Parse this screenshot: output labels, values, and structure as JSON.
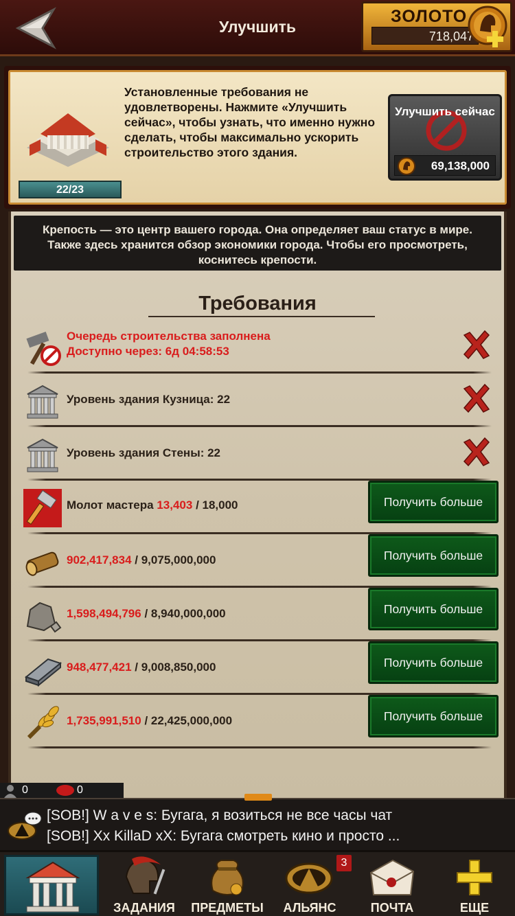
{
  "header": {
    "title": "Улучшить",
    "gold_label": "ЗОЛОТО",
    "gold_value": "718,047"
  },
  "upgrade": {
    "level": "22/23",
    "description": "Установленные требования не удовлетворены. Нажмите «Улучшить сейчас», чтобы узнать, что именно нужно сделать, чтобы максимально ускорить строительство этого здания.",
    "button_label": "Улучшить сейчас",
    "cost": "69,138,000"
  },
  "info_text": "Крепость — это центр вашего города. Она определяет ваш статус в мире. Также здесь хранится обзор экономики города. Чтобы его просмотреть, коснитесь крепости.",
  "requirements": {
    "title": "Требования",
    "queue_line1": "Очередь строительства заполнена",
    "queue_line2": "Доступно через: 6д 04:58:53",
    "forge": "Уровень здания Кузница: 22",
    "walls": "Уровень здания Стены: 22",
    "items": [
      {
        "icon": "master-hammer-icon",
        "label": "Молот мастера",
        "have": "13,403",
        "need": "/ 18,000"
      },
      {
        "icon": "wood-icon",
        "label": "",
        "have": "902,417,834",
        "need": "/ 9,075,000,000"
      },
      {
        "icon": "stone-icon",
        "label": "",
        "have": "1,598,494,796",
        "need": "/ 8,940,000,000"
      },
      {
        "icon": "iron-icon",
        "label": "",
        "have": "948,477,421",
        "need": "/ 9,008,850,000"
      },
      {
        "icon": "wheat-icon",
        "label": "",
        "have": "1,735,991,510",
        "need": "/ 22,425,000,000"
      }
    ],
    "get_more_label": "Получить больше"
  },
  "chat": {
    "players_online": "0",
    "messages_count": "0",
    "line1": "[SOB!] W a v e s: Бугага, я возиться не все часы чат",
    "line2": "[SOB!] Xx KillaD xX: Бугага смотреть кино и просто ..."
  },
  "nav": {
    "tasks": "ЗАДАНИЯ",
    "items": "ПРЕДМЕТЫ",
    "alliance": "АЛЬЯНС",
    "alliance_badge": "3",
    "mail": "ПОЧТА",
    "more": "ЕЩЕ"
  }
}
